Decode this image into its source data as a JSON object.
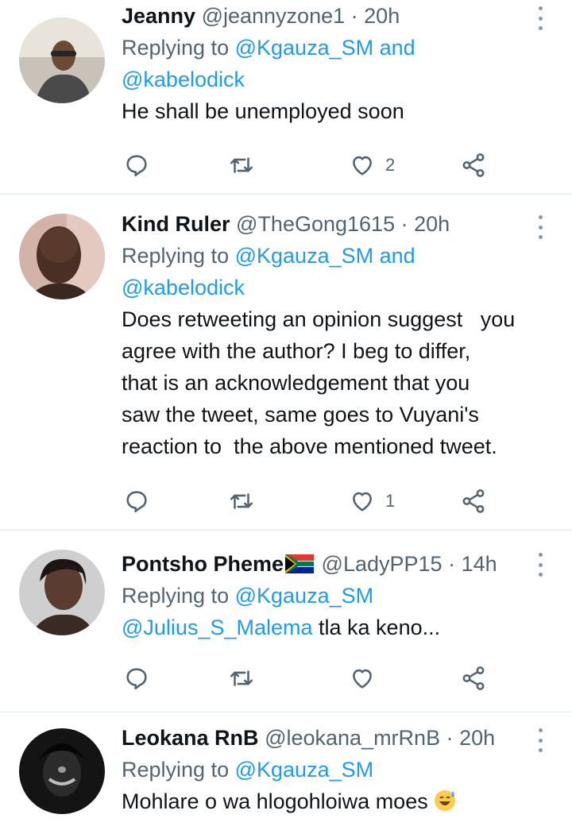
{
  "tweets": [
    {
      "name": "Jeanny",
      "handle": "@jeannyzone1",
      "dot": "·",
      "time": "20h",
      "reply_prefix": "Replying to",
      "reply_mentions": [
        "@Kgauza_SM",
        "@kabelodick"
      ],
      "reply_joiner": "and",
      "body_lines": [
        "He shall be unemployed soon"
      ],
      "like_count": "2"
    },
    {
      "name": "Kind Ruler",
      "handle": "@TheGong1615",
      "dot": "·",
      "time": "20h",
      "reply_prefix": "Replying to",
      "reply_mentions": [
        "@Kgauza_SM",
        "@kabelodick"
      ],
      "reply_joiner": "and",
      "body_lines": [
        "Does retweeting an opinion suggest   you",
        "agree with the author? I beg to differ,",
        "that is an acknowledgement that you",
        "saw the tweet, same goes to Vuyani's",
        "reaction to  the above mentioned tweet."
      ],
      "like_count": "1"
    },
    {
      "name": "Pontsho Pheme",
      "handle": "@LadyPP15",
      "dot": "·",
      "time": "14h",
      "reply_prefix": "Replying to",
      "reply_mentions": [
        "@Kgauza_SM"
      ],
      "body_mention": "@Julius_S_Malema",
      "body_rest": " tla ka keno...",
      "like_count": ""
    },
    {
      "name": "Leokana RnB",
      "handle": "@leokana_mrRnB",
      "dot": "·",
      "time": "20h",
      "reply_prefix": "Replying to",
      "reply_mentions": [
        "@Kgauza_SM"
      ],
      "body_lines": [
        "Mohlare o wa hlogohloiwa moes"
      ]
    }
  ],
  "icons": {
    "reply": "reply-icon",
    "retweet": "retweet-icon",
    "like": "heart-icon",
    "share": "share-icon",
    "more": "more-options-icon",
    "flag": "south-africa-flag-icon",
    "emoji": "grinning-sweat-emoji-icon"
  },
  "colors": {
    "text": "#0f1419",
    "secondary": "#536471",
    "link": "#1d9bf0",
    "divider": "#e1e8ed"
  }
}
